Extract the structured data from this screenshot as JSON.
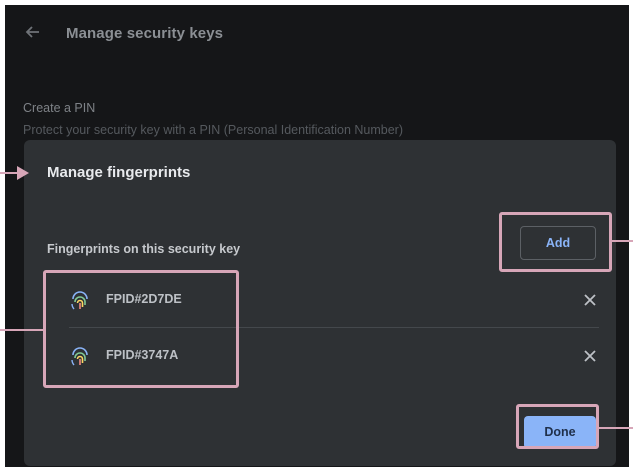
{
  "page": {
    "back_icon": "arrow-left-icon",
    "title": "Manage security keys"
  },
  "pin_section": {
    "label": "Create a PIN",
    "description": "Protect your security key with a PIN (Personal Identification Number)"
  },
  "dialog": {
    "title": "Manage fingerprints",
    "section_label": "Fingerprints on this security key",
    "add_label": "Add",
    "done_label": "Done",
    "fingerprints": [
      {
        "id": "FPID#2D7DE",
        "icon": "fingerprint-icon",
        "remove_icon": "close-icon"
      },
      {
        "id": "FPID#3747A",
        "icon": "fingerprint-icon",
        "remove_icon": "close-icon"
      }
    ]
  },
  "colors": {
    "background": "#151618",
    "dialog": "#2e3134",
    "accent": "#8ab4f8",
    "annotation": "#d7a6b8"
  }
}
